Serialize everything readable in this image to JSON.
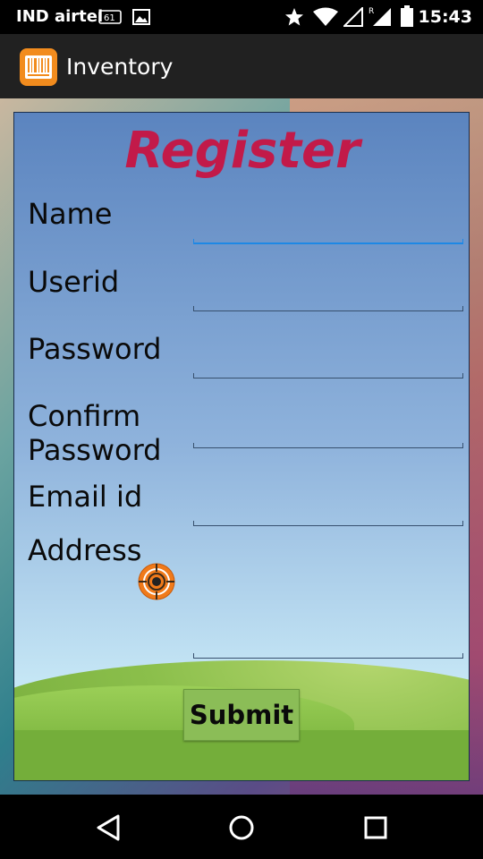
{
  "status_bar": {
    "carrier": "IND airtel",
    "time": "15:43",
    "icons": [
      "nfc-icon",
      "image-icon",
      "star-icon",
      "wifi-icon",
      "signal-icon",
      "roaming-signal-icon",
      "battery-icon"
    ]
  },
  "app_bar": {
    "title": "Inventory",
    "logo_icon": "barcode-icon",
    "accent": "#f28c1e"
  },
  "form": {
    "title": "Register",
    "title_color": "#c21a49",
    "fields": [
      {
        "label": "Name",
        "value": "",
        "focused": true
      },
      {
        "label": "Userid",
        "value": ""
      },
      {
        "label": "Password",
        "value": ""
      },
      {
        "label": "Confirm Password",
        "value": ""
      },
      {
        "label": "Email id",
        "value": ""
      },
      {
        "label": "Address",
        "value": ""
      }
    ],
    "location_icon": "gps-target-icon",
    "submit_label": "Submit"
  },
  "nav_bar": {
    "back_icon": "back-triangle-icon",
    "home_icon": "home-circle-icon",
    "recents_icon": "recents-square-icon"
  }
}
